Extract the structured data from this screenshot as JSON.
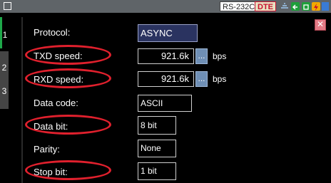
{
  "statusbar": {
    "interface": "RS-232C",
    "mode": "DTE"
  },
  "tabs": [
    {
      "label": "1"
    },
    {
      "label": "2"
    },
    {
      "label": "3"
    }
  ],
  "close_button": {
    "label": "✕"
  },
  "settings": {
    "protocol": {
      "label": "Protocol:",
      "value": "ASYNC"
    },
    "txd_speed": {
      "label": "TXD speed:",
      "value": "921.6k",
      "more": "...",
      "unit": "bps"
    },
    "rxd_speed": {
      "label": "RXD speed:",
      "value": "921.6k",
      "more": "...",
      "unit": "bps"
    },
    "data_code": {
      "label": "Data code:",
      "value": "ASCII"
    },
    "data_bit": {
      "label": "Data bit:",
      "value": "8 bit"
    },
    "parity": {
      "label": "Parity:",
      "value": "None"
    },
    "stop_bit": {
      "label": "Stop bit:",
      "value": "1 bit"
    }
  },
  "colors": {
    "highlight_ellipse": "#e0202d",
    "active_tab": "#1ea84a",
    "selected_field": "#2a3360"
  }
}
